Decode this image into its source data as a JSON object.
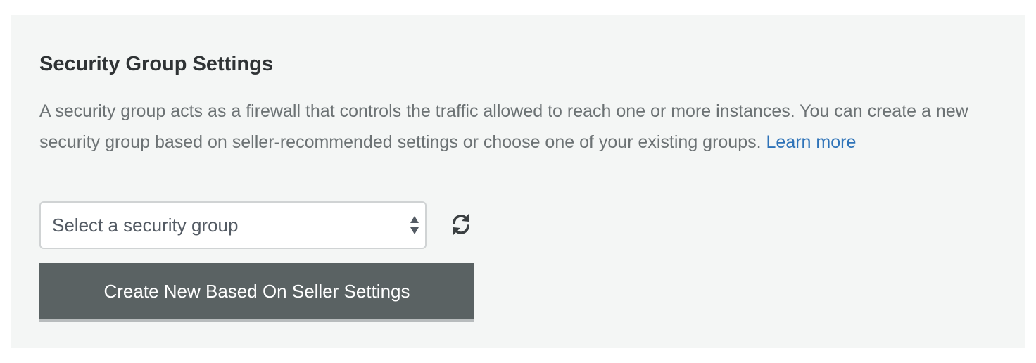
{
  "section": {
    "title": "Security Group Settings",
    "description": "A security group acts as a firewall that controls the traffic allowed to reach one or more instances. You can create a new security group based on seller-recommended settings or choose one of your existing groups.",
    "learn_more_label": "Learn more"
  },
  "security_group_select": {
    "placeholder": "Select a security group",
    "icon": "sort-arrows-icon"
  },
  "refresh": {
    "icon": "refresh-icon"
  },
  "create_button": {
    "label": "Create New Based On Seller Settings"
  },
  "colors": {
    "panel_background": "#f4f6f5",
    "title": "#2f3335",
    "body_text": "#6c7274",
    "link": "#2e73b8",
    "button_background": "#5a6263",
    "button_text": "#ffffff"
  }
}
